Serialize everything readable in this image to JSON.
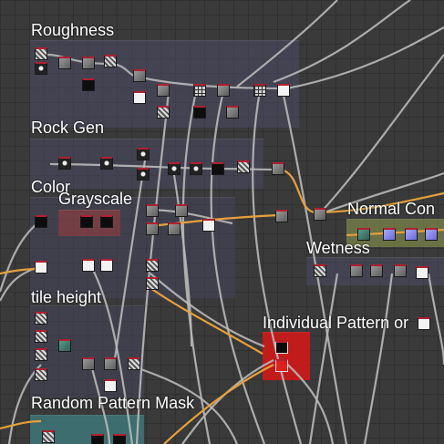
{
  "app": {
    "view": "node-graph"
  },
  "colors": {
    "canvas_bg": "#3a3a3a",
    "grid_line": "#303030",
    "frame_purple": "#4a4a66",
    "frame_olive": "#7f8a4a",
    "frame_teal": "#3f7f80",
    "frame_red": "#d01818",
    "wire_grey": "#b9b9b9",
    "wire_orange": "#e6a03a",
    "port_red": "#c42a2a"
  },
  "frames": {
    "roughness": "Roughness",
    "rock_gen": "Rock Gen",
    "color": "Color",
    "grayscale": "Grayscale",
    "normal_combine": "Normal Con",
    "wetness": "Wetness",
    "tile_height": "tile height",
    "individual_pattern": "Individual Pattern or",
    "random_pattern_mask": "Random Pattern Mask"
  }
}
